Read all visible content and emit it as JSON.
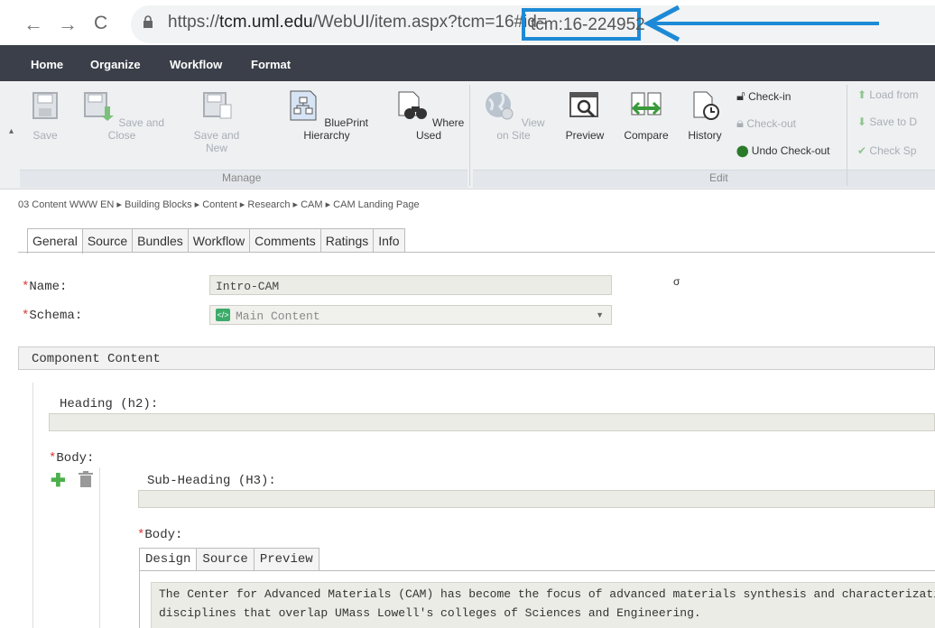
{
  "browser": {
    "url_prefix": "https://",
    "url_host": "tcm.uml.edu",
    "url_path": "/WebUI/item.aspx?tcm=16#id=",
    "url_highlight": "tcm:16-224952"
  },
  "ribbon_tabs": [
    "Home",
    "Organize",
    "Workflow",
    "Format"
  ],
  "ribbon": {
    "save": "Save",
    "save_close": "Save and Close",
    "save_new_1": "Save and",
    "save_new_2": "New",
    "blueprint": "BluePrint Hierarchy",
    "where_used": "Where Used",
    "view_site": "View on Site",
    "preview": "Preview",
    "compare": "Compare",
    "history": "History",
    "check_in": "Check-in",
    "check_out": "Check-out",
    "undo_checkout": "Undo Check-out",
    "load_from": "Load from",
    "save_to": "Save to D",
    "check_spelling": "Check Sp",
    "group_manage": "Manage",
    "group_edit": "Edit"
  },
  "breadcrumb": "03 Content WWW EN  ▸  Building Blocks  ▸  Content  ▸  Research  ▸  CAM  ▸  CAM Landing Page",
  "form_tabs": [
    "General",
    "Source",
    "Bundles",
    "Workflow",
    "Comments",
    "Ratings",
    "Info"
  ],
  "form": {
    "required_mark": "*",
    "name_label": "Name:",
    "name_value": "Intro-CAM",
    "schema_label": "Schema:",
    "schema_value": "Main Content",
    "small_mark": "σ",
    "section_title": "Component Content",
    "heading_label": "Heading (h2):",
    "body_label": "Body:",
    "subheading_label": "Sub-Heading (H3):",
    "inner_body_label": "Body:"
  },
  "editor_tabs": [
    "Design",
    "Source",
    "Preview"
  ],
  "editor": {
    "line1": "The Center for Advanced Materials (CAM) has become the focus of advanced materials synthesis and characterization at UM",
    "line2": "disciplines that overlap UMass Lowell's colleges of Sciences and Engineering."
  },
  "colors": {
    "highlight": "#1d8ad6",
    "tabbar": "#3a3f49",
    "ribbon_bg": "#eef0f2"
  }
}
